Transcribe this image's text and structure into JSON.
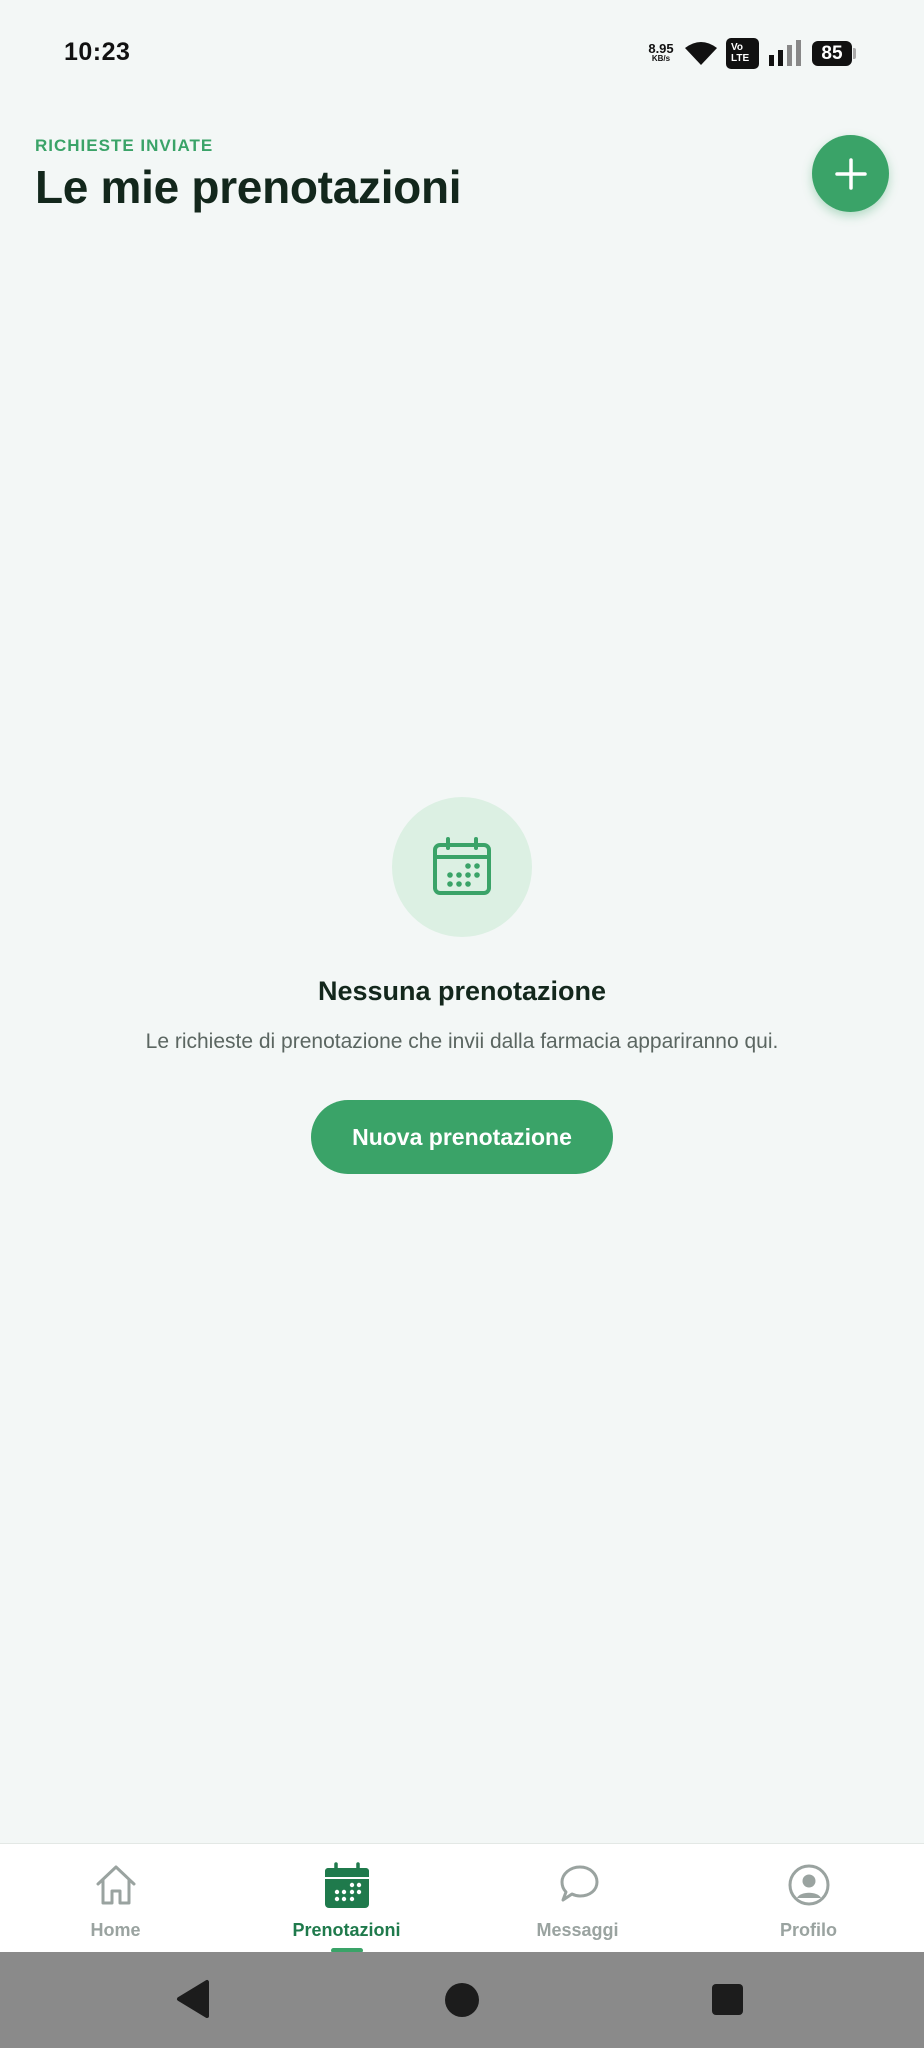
{
  "status_bar": {
    "time": "10:23",
    "net_speed_value": "8.95",
    "net_speed_unit": "KB/s",
    "volte_line1": "Vo",
    "volte_line2": "LTE",
    "battery": "85"
  },
  "header": {
    "eyebrow": "RICHIESTE INVIATE",
    "title": "Le mie prenotazioni"
  },
  "empty_state": {
    "title": "Nessuna prenotazione",
    "description": "Le richieste di prenotazione che invii dalla farmacia appariranno qui.",
    "button_label": "Nuova prenotazione"
  },
  "bottom_nav": {
    "items": [
      {
        "label": "Home",
        "icon": "home-icon",
        "active": false
      },
      {
        "label": "Prenotazioni",
        "icon": "calendar-icon",
        "active": true
      },
      {
        "label": "Messaggi",
        "icon": "chat-icon",
        "active": false
      },
      {
        "label": "Profilo",
        "icon": "profile-icon",
        "active": false
      }
    ]
  },
  "colors": {
    "accent": "#3aa368",
    "accent_dark": "#1f7a4c",
    "background": "#f3f7f6",
    "text_primary": "#13271c",
    "text_muted": "#9aa3a0"
  }
}
